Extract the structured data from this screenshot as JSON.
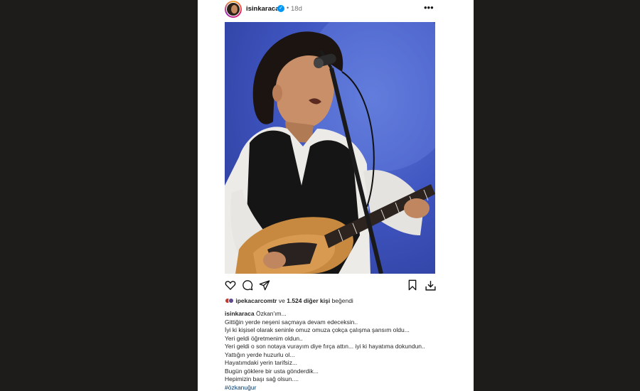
{
  "post": {
    "username": "isinkaraca",
    "separator": "•",
    "time": "18d",
    "more_icon": "more-horizontal-icon",
    "likes": {
      "liker": "ipekacarcomtr",
      "connector": "ve",
      "others": "1.524 diğer kişi",
      "suffix": "beğendi"
    },
    "caption": {
      "author": "isinkaraca",
      "first_line": "Özkan'ım...",
      "lines": [
        "Gittiğin yerde neşeni saçmaya devam edeceksin..",
        "İyi ki kişisel olarak seninle omuz omuza çokça çalışma şansım oldu...",
        "Yeri geldi öğretmenim oldun..",
        "Yeri geldi o son notaya vurayım diye fırça attın... iyi ki hayatıma dokundun..",
        "Yattığın yerde huzurlu ol...",
        "Hayatımdaki yerin tarifsiz...",
        "Bugün göklere bir usta gönderdik...",
        "Hepimizin başı sağ olsun...."
      ],
      "hashtag": "#özkanuğur"
    },
    "icons": [
      "heart-icon",
      "comment-icon",
      "share-icon",
      "bookmark-icon",
      "download-icon"
    ],
    "colors": {
      "background": "#1e1c1b",
      "card": "#ffffff",
      "verified": "#0095f6",
      "hashtag": "#00376b",
      "muted": "#737373"
    }
  }
}
